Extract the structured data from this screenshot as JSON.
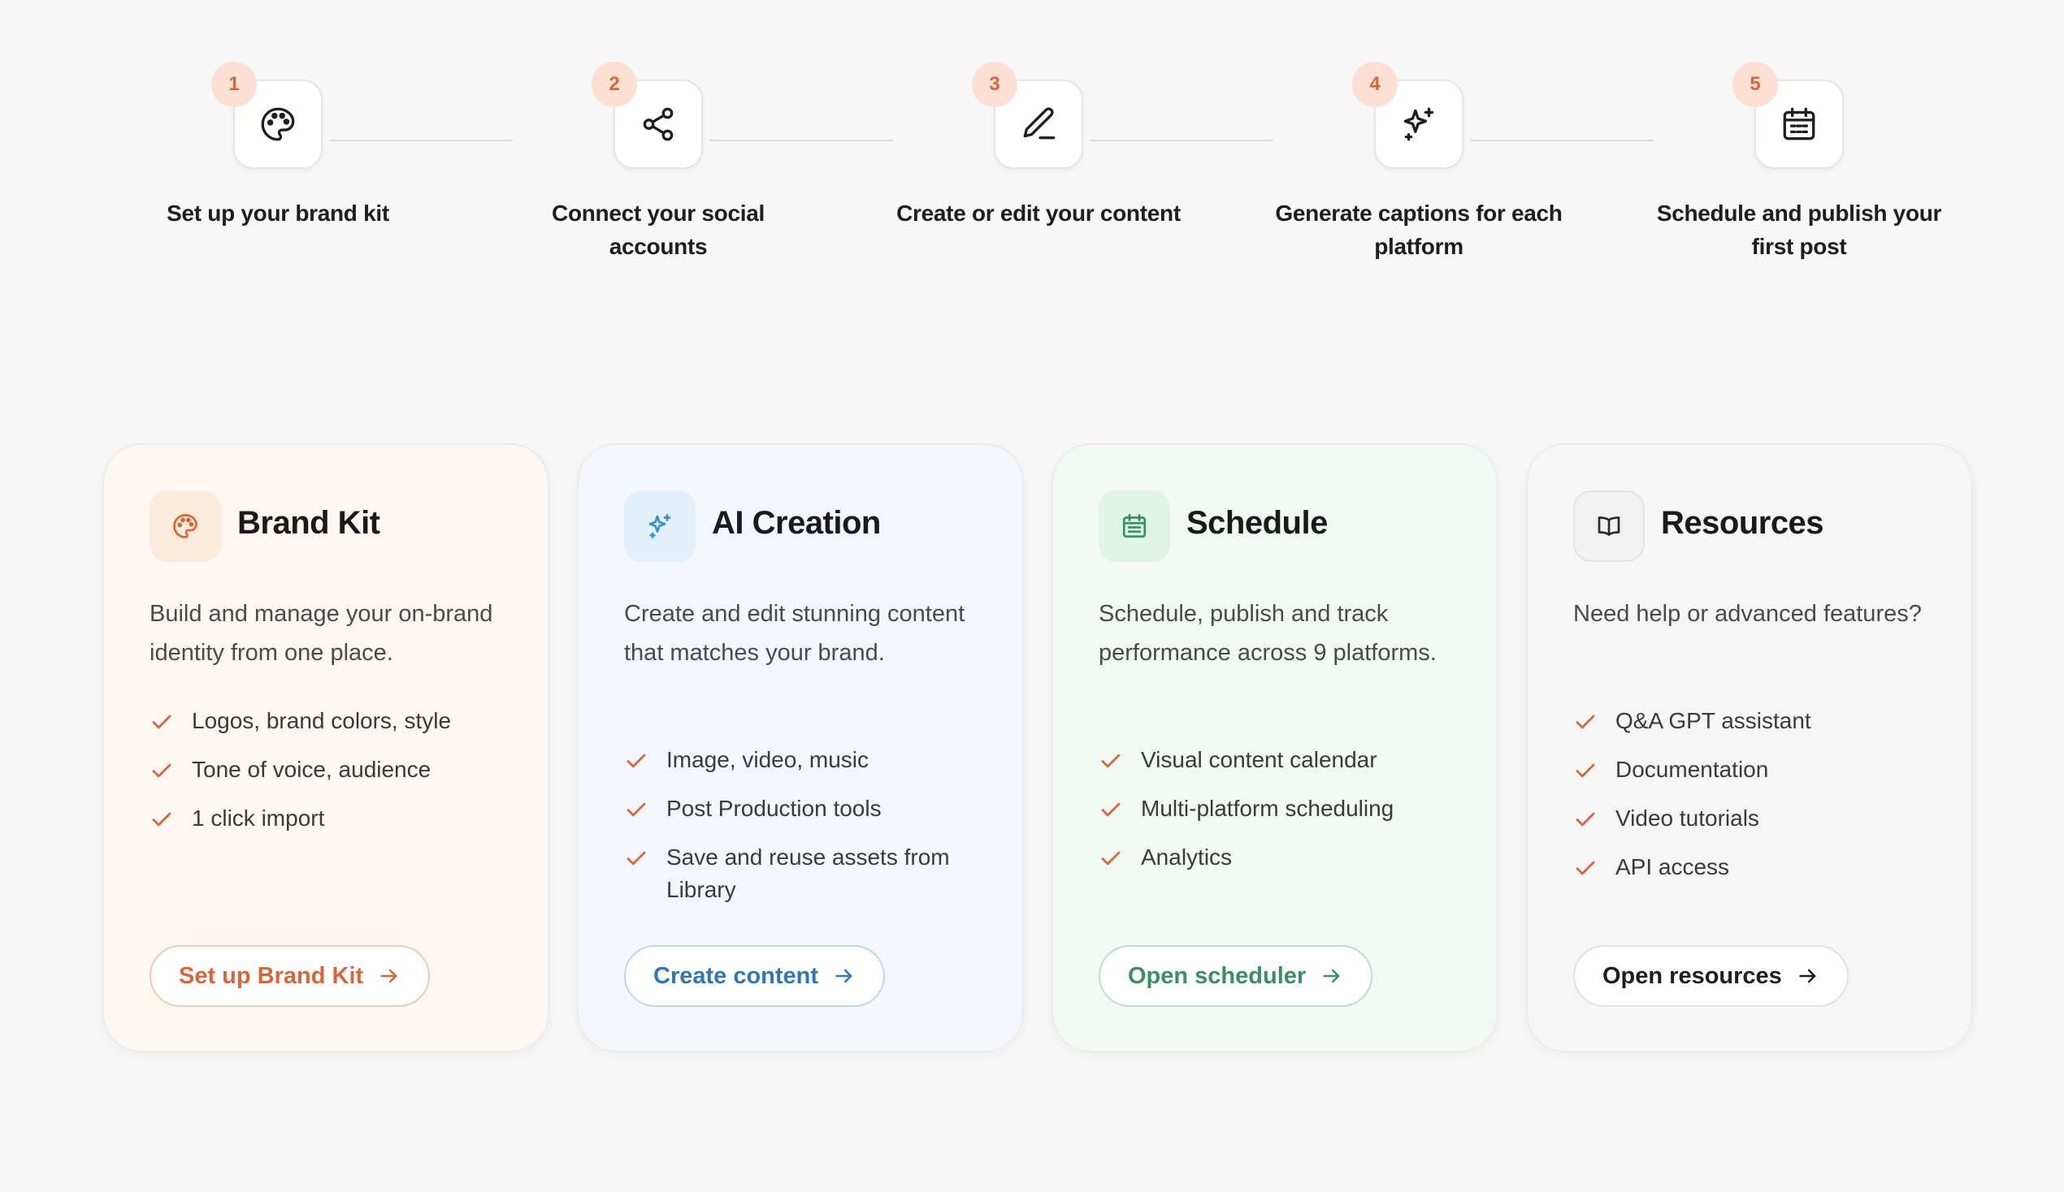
{
  "steps": [
    {
      "number": "1",
      "label": "Set up your brand kit",
      "icon": "palette-icon"
    },
    {
      "number": "2",
      "label": "Connect your social accounts",
      "icon": "share-icon"
    },
    {
      "number": "3",
      "label": "Create or edit your content",
      "icon": "pencil-icon"
    },
    {
      "number": "4",
      "label": "Generate captions for each platform",
      "icon": "sparkles-icon"
    },
    {
      "number": "5",
      "label": "Schedule and publish your first post",
      "icon": "calendar-icon"
    }
  ],
  "cards": [
    {
      "title": "Brand Kit",
      "description": "Build and manage your on-brand identity from one place.",
      "features": [
        "Logos, brand colors, style",
        "Tone of voice, audience",
        "1 click import"
      ],
      "button_label": "Set up Brand Kit",
      "icon": "palette-icon",
      "accent": "#d9653a",
      "background": "#fdf7f1",
      "icon_bg": "#fcebd9"
    },
    {
      "title": "AI Creation",
      "description": "Create and edit stunning content that matches your brand.",
      "features": [
        "Image, video, music",
        "Post Production tools",
        "Save and reuse assets from Library"
      ],
      "button_label": "Create content",
      "icon": "sparkles-icon",
      "accent": "#2f78b8",
      "background": "#f3f7fc",
      "icon_bg": "#e2f0fb"
    },
    {
      "title": "Schedule",
      "description": "Schedule, publish and track performance across 9 platforms.",
      "features": [
        "Visual content calendar",
        "Multi-platform scheduling",
        "Analytics"
      ],
      "button_label": "Open scheduler",
      "icon": "calendar-icon",
      "accent": "#3a8f64",
      "background": "#f2f9f3",
      "icon_bg": "#dff3e6"
    },
    {
      "title": "Resources",
      "description": "Need help or advanced features?",
      "features": [
        "Q&A GPT assistant",
        "Documentation",
        "Video tutorials",
        "API access"
      ],
      "button_label": "Open resources",
      "icon": "book-icon",
      "accent": "#1f1f1f",
      "background": "#f6f6f6",
      "icon_bg": "#f1f1f1"
    }
  ],
  "colors": {
    "check": "#d9653a",
    "badge_bg": "#fbe0d3",
    "badge_text": "#d9653a",
    "page_bg": "#f7f7f7"
  }
}
